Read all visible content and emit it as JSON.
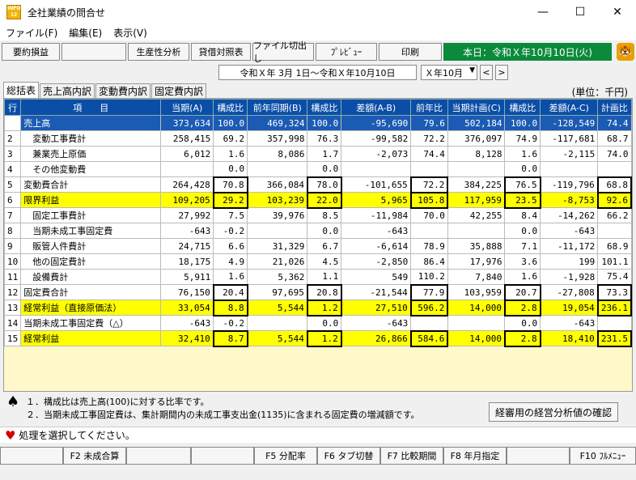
{
  "window": {
    "title": "全社業績の問合せ",
    "app_icon_text": "INFO 12",
    "minimize": "—",
    "maximize": "☐",
    "close": "✕"
  },
  "menu": [
    {
      "label": "ファイル(F)"
    },
    {
      "label": "編集(E)"
    },
    {
      "label": "表示(V)"
    }
  ],
  "toolbar": {
    "buttons": [
      {
        "label": "要約損益"
      },
      {
        "label": ""
      },
      {
        "label": "生産性分析"
      },
      {
        "label": "貸借対照表"
      },
      {
        "label": "ファイル切出し"
      },
      {
        "label": "ﾌﾟﾚﾋﾞｭｰ"
      },
      {
        "label": "印刷"
      }
    ],
    "today": "本日：令和Ｘ年10月10日(火)"
  },
  "period": {
    "range": "令和Ｘ年 3月 1日～令和Ｘ年10月10日",
    "month": "Ｘ年10月",
    "prev": "<",
    "next": ">"
  },
  "tabs": [
    {
      "label": "総括表"
    },
    {
      "label": "売上高内訳"
    },
    {
      "label": "変動費内訳"
    },
    {
      "label": "固定費内訳"
    }
  ],
  "unit": "(単位：千円)",
  "table": {
    "headers": [
      "行",
      "項　　目",
      "当期(A)",
      "構成比",
      "前年同期(B)",
      "構成比",
      "差額(A-B)",
      "前年比",
      "当期計画(C)",
      "構成比",
      "差額(A-C)",
      "計画比"
    ],
    "rows": [
      {
        "no": "1",
        "item": "売上高",
        "a": "373,634",
        "ra": "100.0",
        "b": "469,324",
        "rb": "100.0",
        "ab": "-95,690",
        "yoy": "79.6",
        "c": "502,184",
        "rc": "100.0",
        "ac": "-128,549",
        "plan": "74.4"
      },
      {
        "no": "2",
        "item": "　変動工事費計",
        "a": "258,415",
        "ra": "69.2",
        "b": "357,998",
        "rb": "76.3",
        "ab": "-99,582",
        "yoy": "72.2",
        "c": "376,097",
        "rc": "74.9",
        "ac": "-117,681",
        "plan": "68.7"
      },
      {
        "no": "3",
        "item": "　兼業売上原価",
        "a": "6,012",
        "ra": "1.6",
        "b": "8,086",
        "rb": "1.7",
        "ab": "-2,073",
        "yoy": "74.4",
        "c": "8,128",
        "rc": "1.6",
        "ac": "-2,115",
        "plan": "74.0"
      },
      {
        "no": "4",
        "item": "　その他変動費",
        "a": "",
        "ra": "0.0",
        "b": "",
        "rb": "0.0",
        "ab": "",
        "yoy": "",
        "c": "",
        "rc": "0.0",
        "ac": "",
        "plan": ""
      },
      {
        "no": "5",
        "item": "変動費合計",
        "a": "264,428",
        "ra": "70.8",
        "b": "366,084",
        "rb": "78.0",
        "ab": "-101,655",
        "yoy": "72.2",
        "c": "384,225",
        "rc": "76.5",
        "ac": "-119,796",
        "plan": "68.8"
      },
      {
        "no": "6",
        "item": "限界利益",
        "a": "109,205",
        "ra": "29.2",
        "b": "103,239",
        "rb": "22.0",
        "ab": "5,965",
        "yoy": "105.8",
        "c": "117,959",
        "rc": "23.5",
        "ac": "-8,753",
        "plan": "92.6"
      },
      {
        "no": "7",
        "item": "　固定工事費計",
        "a": "27,992",
        "ra": "7.5",
        "b": "39,976",
        "rb": "8.5",
        "ab": "-11,984",
        "yoy": "70.0",
        "c": "42,255",
        "rc": "8.4",
        "ac": "-14,262",
        "plan": "66.2"
      },
      {
        "no": "8",
        "item": "　当期未成工事固定費",
        "a": "-643",
        "ra": "-0.2",
        "b": "",
        "rb": "0.0",
        "ab": "-643",
        "yoy": "",
        "c": "",
        "rc": "0.0",
        "ac": "-643",
        "plan": ""
      },
      {
        "no": "9",
        "item": "　販管人件費計",
        "a": "24,715",
        "ra": "6.6",
        "b": "31,329",
        "rb": "6.7",
        "ab": "-6,614",
        "yoy": "78.9",
        "c": "35,888",
        "rc": "7.1",
        "ac": "-11,172",
        "plan": "68.9"
      },
      {
        "no": "10",
        "item": "　他の固定費計",
        "a": "18,175",
        "ra": "4.9",
        "b": "21,026",
        "rb": "4.5",
        "ab": "-2,850",
        "yoy": "86.4",
        "c": "17,976",
        "rc": "3.6",
        "ac": "199",
        "plan": "101.1"
      },
      {
        "no": "11",
        "item": "　設備費計",
        "a": "5,911",
        "ra": "1.6",
        "b": "5,362",
        "rb": "1.1",
        "ab": "549",
        "yoy": "110.2",
        "c": "7,840",
        "rc": "1.6",
        "ac": "-1,928",
        "plan": "75.4"
      },
      {
        "no": "12",
        "item": "固定費合計",
        "a": "76,150",
        "ra": "20.4",
        "b": "97,695",
        "rb": "20.8",
        "ab": "-21,544",
        "yoy": "77.9",
        "c": "103,959",
        "rc": "20.7",
        "ac": "-27,808",
        "plan": "73.3"
      },
      {
        "no": "13",
        "item": "経常利益（直接原価法）",
        "a": "33,054",
        "ra": "8.8",
        "b": "5,544",
        "rb": "1.2",
        "ab": "27,510",
        "yoy": "596.2",
        "c": "14,000",
        "rc": "2.8",
        "ac": "19,054",
        "plan": "236.1"
      },
      {
        "no": "14",
        "item": "当期未成工事固定費（△）",
        "a": "-643",
        "ra": "-0.2",
        "b": "",
        "rb": "0.0",
        "ab": "-643",
        "yoy": "",
        "c": "",
        "rc": "0.0",
        "ac": "-643",
        "plan": ""
      },
      {
        "no": "15",
        "item": "経常利益",
        "a": "32,410",
        "ra": "8.7",
        "b": "5,544",
        "rb": "1.2",
        "ab": "26,866",
        "yoy": "584.6",
        "c": "14,000",
        "rc": "2.8",
        "ac": "18,410",
        "plan": "231.5"
      }
    ]
  },
  "notes": [
    "１．構成比は売上高(100)に対する比率です。",
    "２．当期未成工事固定費は、集計期間内の未成工事支出金(1135)に含まれる固定費の増減額です。"
  ],
  "confirm_button": "経審用の経営分析値の確認",
  "status": "処理を選択してください。",
  "fkeys": [
    {
      "label": ""
    },
    {
      "label": "F2 未成合算"
    },
    {
      "label": ""
    },
    {
      "label": ""
    },
    {
      "label": "F5 分配率"
    },
    {
      "label": "F6 タブ切替"
    },
    {
      "label": "F7 比較期間"
    },
    {
      "label": "F8 年月指定"
    },
    {
      "label": ""
    },
    {
      "label": "F10 ﾌﾙﾒﾆｭｰ"
    }
  ]
}
